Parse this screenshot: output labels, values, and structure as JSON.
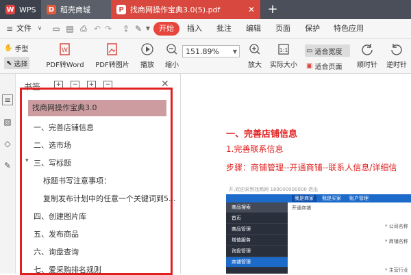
{
  "tabs": [
    {
      "label": "WPS",
      "icon": "wps-logo-icon"
    },
    {
      "label": "稻壳商城",
      "icon": "docer-logo-icon"
    },
    {
      "label": "找商网操作宝典3.0(5).pdf",
      "icon": "pdf-file-icon"
    }
  ],
  "menubar": {
    "file_label": "文件",
    "start_label": "开始",
    "items": [
      "插入",
      "批注",
      "编辑",
      "页面",
      "保护",
      "特色应用"
    ]
  },
  "ribbon": {
    "hand_label": "手型",
    "select_label": "选择",
    "pdf_to_word": "PDF转Word",
    "pdf_to_image": "PDF转图片",
    "play_label": "播放",
    "zoom_value": "151.89%",
    "zoom_out": "缩小",
    "zoom_in": "放大",
    "actual_size": "实际大小",
    "fit_width": "适合宽度",
    "fit_page": "适合页面",
    "rotate_cw": "顺时针",
    "rotate_ccw": "逆时针"
  },
  "bookmark_panel": {
    "title": "书签",
    "items": [
      "找商网操作宝典3.0",
      "一、完善店铺信息",
      "二、选市场",
      "三、写标题",
      "标题书写注意事项：",
      "复制发布计划中的任意一个关键词到5...",
      "四、创建图片库",
      "五、发布商品",
      "六、询盘查询",
      "七、爱采购排名规则"
    ],
    "collapse_marker": "▾"
  },
  "document": {
    "heading": "一、完善店铺信息",
    "subheading": "1.完善联系信息",
    "step_text": "步骤：商铺管理--开通商铺--联系人信息/详细信",
    "screenshot": {
      "top_text": "开,欢迎来到找商网 189000000000 退出",
      "nav_items": [
        "我是商家",
        "我是买家",
        "账户管理"
      ],
      "search_placeholder": "商品搜索",
      "side_items": [
        "首页",
        "商品管理",
        "增值服务",
        "询盘管理",
        "商铺管理"
      ],
      "main_title": "开通商铺",
      "field_labels": [
        "* 公司名称",
        "* 商铺名称",
        "* 主营行业"
      ]
    }
  },
  "colors": {
    "accent_red": "#e02020",
    "tab_active": "#d9483e",
    "start_button": "#e8453c",
    "selected_bookmark": "#cd9ca0"
  }
}
